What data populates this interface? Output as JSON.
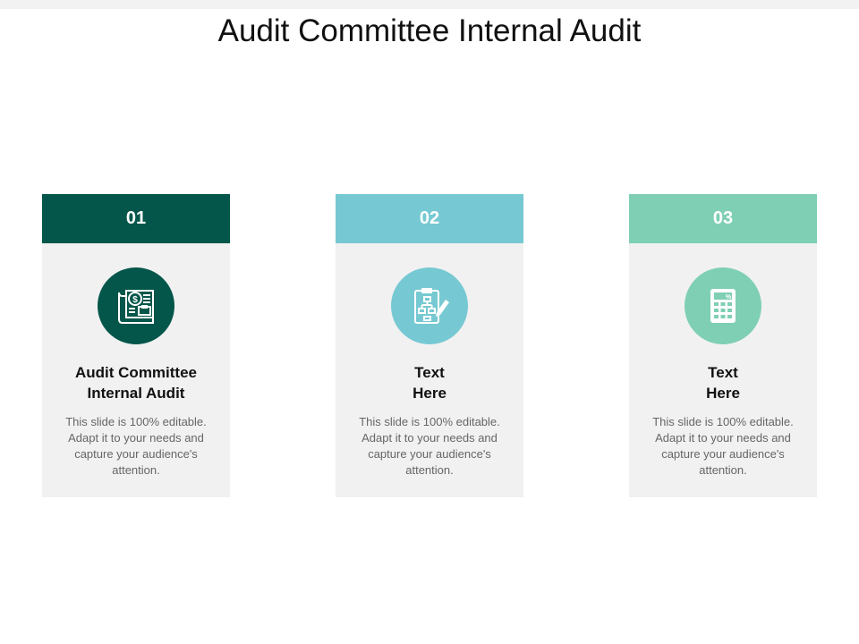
{
  "slide": {
    "title": "Audit Committee Internal Audit"
  },
  "cards": [
    {
      "number": "01",
      "title_line1": "Audit Committee",
      "title_line2": "Internal Audit",
      "body": "This slide is 100% editable. Adapt it to your needs and capture your audience's attention.",
      "color": "#04564a",
      "icon": "financial-report-icon"
    },
    {
      "number": "02",
      "title_line1": "Text",
      "title_line2": "Here",
      "body": "This slide is 100% editable. Adapt it to your needs and capture your audience's attention.",
      "color": "#76c9d2",
      "icon": "clipboard-flowchart-icon"
    },
    {
      "number": "03",
      "title_line1": "Text",
      "title_line2": "Here",
      "body": "This slide is 100% editable. Adapt it to your needs and capture your audience's attention.",
      "color": "#7fcfb4",
      "icon": "calculator-icon",
      "icon_label": "%"
    }
  ],
  "colors": {
    "card_background": "#f1f1f1",
    "icon_foreground": "#ffffff"
  }
}
